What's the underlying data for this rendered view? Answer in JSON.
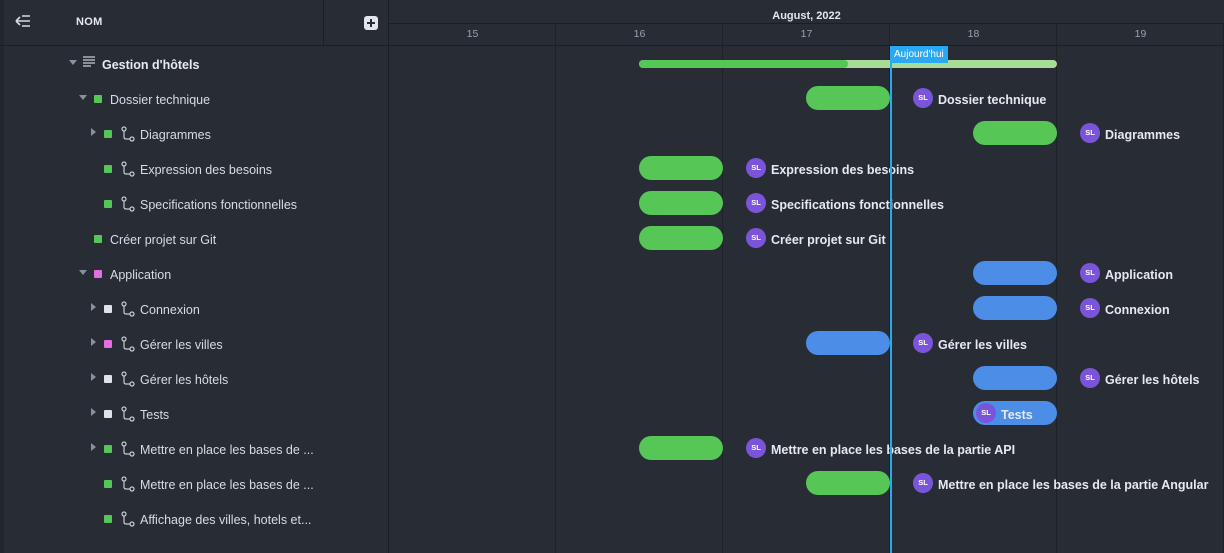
{
  "header": {
    "name_column": "NOM",
    "month": "August, 2022"
  },
  "days": [
    "15",
    "16",
    "17",
    "18",
    "19"
  ],
  "today_label": "Aujourd'hui",
  "colors": {
    "green": "#56c756",
    "blue": "#4c8de8",
    "pink": "#e36de3",
    "white": "#dfe3e8",
    "today": "#2aa8f2",
    "avatar": "#7b55d9"
  },
  "project": {
    "label": "Gestion d'hôtels",
    "progress": 0.5
  },
  "tasks": [
    {
      "label": "Dossier technique",
      "bar_label": "Dossier technique",
      "avatar": "SL"
    },
    {
      "label": "Diagrammes",
      "bar_label": "Diagrammes",
      "avatar": "SL"
    },
    {
      "label": "Expression des besoins",
      "bar_label": "Expression des besoins",
      "avatar": "SL"
    },
    {
      "label": "Specifications fonctionnelles",
      "bar_label": "Specifications fonctionnelles",
      "avatar": "SL"
    },
    {
      "label": "Créer projet sur Git",
      "bar_label": "Créer projet sur Git",
      "avatar": "SL"
    },
    {
      "label": "Application",
      "bar_label": "Application",
      "avatar": "SL"
    },
    {
      "label": "Connexion",
      "bar_label": "Connexion",
      "avatar": "SL"
    },
    {
      "label": "Gérer les villes",
      "bar_label": "Gérer les villes",
      "avatar": "SL"
    },
    {
      "label": "Gérer les hôtels",
      "bar_label": "Gérer les hôtels",
      "avatar": "SL"
    },
    {
      "label": "Tests",
      "bar_label": "Tests",
      "avatar": "SL"
    },
    {
      "label": "Mettre en place les bases de ...",
      "bar_label": "Mettre en place les bases de la partie API",
      "avatar": "SL"
    },
    {
      "label": "Mettre en place les bases de ...",
      "bar_label": "Mettre en place les bases de la partie Angular",
      "avatar": "SL"
    },
    {
      "label": "Affichage des villes, hotels et..."
    }
  ]
}
